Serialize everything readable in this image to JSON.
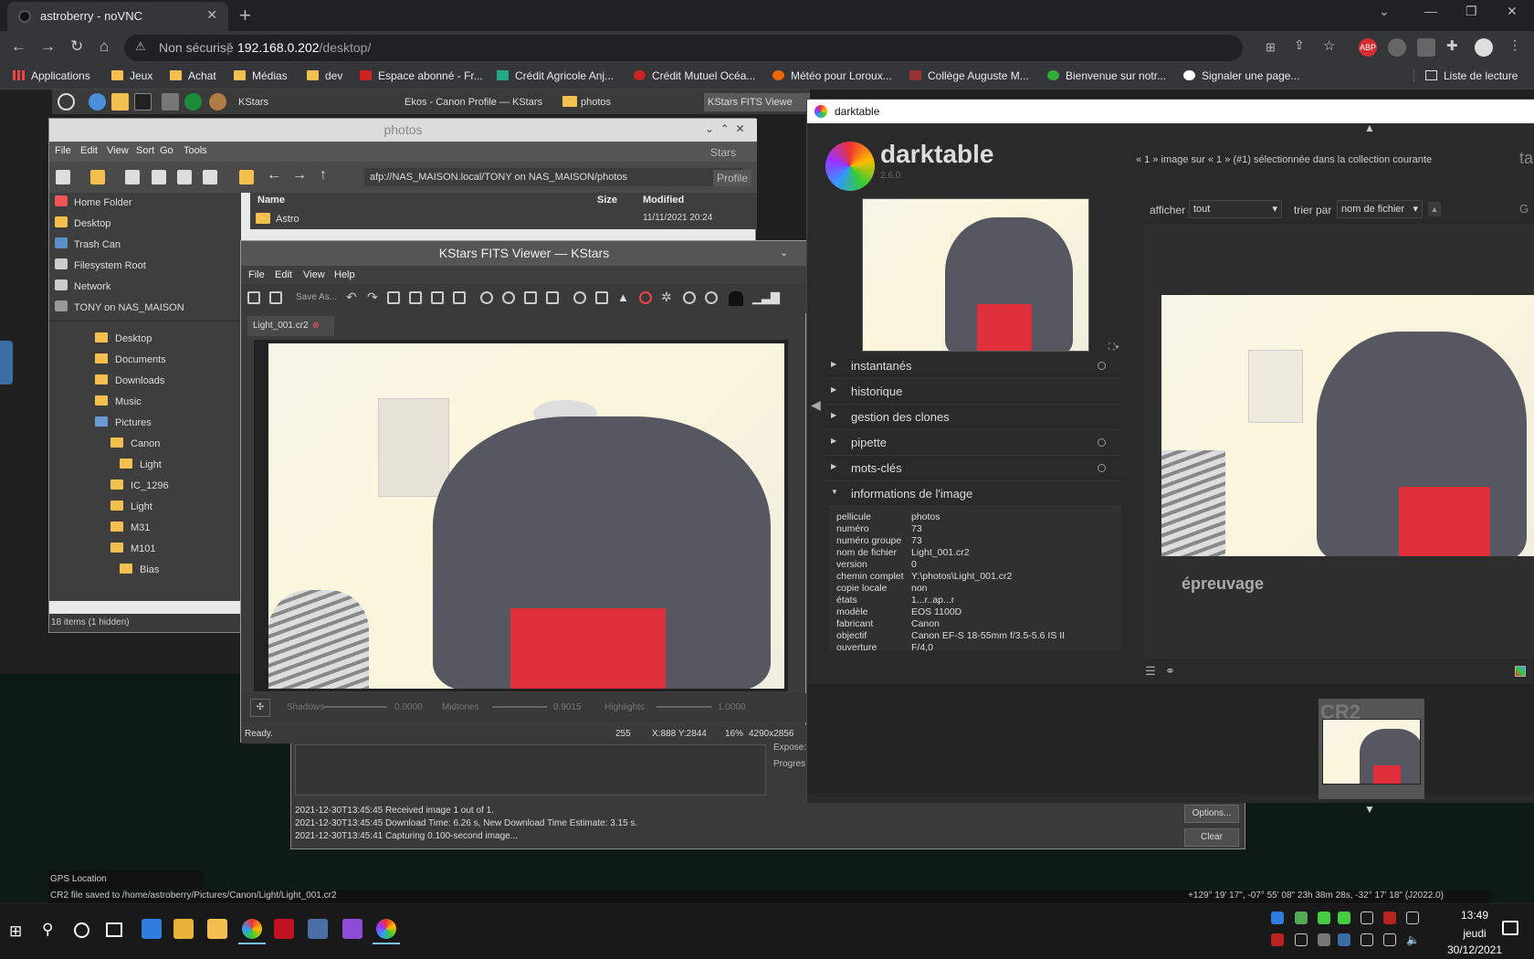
{
  "browser": {
    "tab_title": "astroberry - noVNC",
    "new_tab": "+",
    "url_prefix": "Non sécurisé",
    "url_host": "192.168.0.202",
    "url_path": "/desktop/",
    "bookmarks": [
      "Applications",
      "Jeux",
      "Achat",
      "Médias",
      "dev",
      "Espace abonné - Fr...",
      "Crédit Agricole Anj...",
      "Crédit Mutuel Océa...",
      "Météo pour Loroux...",
      "Collège Auguste M...",
      "Bienvenue sur notr...",
      "Signaler une page..."
    ],
    "reading_list": "Liste de lecture",
    "abp": "ABP"
  },
  "panel": {
    "tasks": [
      "KStars",
      "Ekos - Canon Profile — KStars",
      "photos",
      "KStars FITS Viewe"
    ]
  },
  "pcmanfm": {
    "title": "photos",
    "menu": [
      "File",
      "Edit",
      "View",
      "Sort",
      "Go",
      "Tools"
    ],
    "path": "afp://NAS_MAISON.local/TONY on NAS_MAISON/photos",
    "places": [
      "Home Folder",
      "Desktop",
      "Trash Can",
      "Filesystem Root",
      "Network",
      "TONY on NAS_MAISON"
    ],
    "tree": [
      "Desktop",
      "Documents",
      "Downloads",
      "Music",
      "Pictures",
      "Canon",
      "Light",
      "IC_1296",
      "Light",
      "M31",
      "M101",
      "Bias"
    ],
    "columns": [
      "Name",
      "Size",
      "Modified"
    ],
    "file": {
      "name": "Astro",
      "modified": "11/11/2021 20:24"
    },
    "status": "18 items (1 hidden)",
    "stars_tab": "Stars",
    "profile_tab": "Profile"
  },
  "ekos": {
    "log": [
      "2021-12-30T13:45:45 Received image 1 out of 1.",
      "2021-12-30T13:45:45 Download Time: 6.26 s, New Download Time Estimate: 3.15 s.",
      "2021-12-30T13:45:41 Capturing 0.100-second  image..."
    ],
    "options": "Options...",
    "clear": "Clear",
    "expose": "Expose:",
    "progress": "Progres"
  },
  "fits": {
    "title": "KStars FITS Viewer — KStars",
    "menu": [
      "File",
      "Edit",
      "View",
      "Help"
    ],
    "save_as": "Save As...",
    "tab": "Light_001.cr2",
    "shadows": "Shadows",
    "shadows_val": "0.0000",
    "midtones": "Midtones",
    "midtones_val": "0.9015",
    "highlights": "Highlights",
    "highlights_val": "1.0000",
    "status": "Ready.",
    "value": "255",
    "coords": "X:888 Y:2844",
    "zoom": "16%",
    "size": "4290x2856"
  },
  "darktable": {
    "title": "darktable",
    "name": "darktable",
    "version": "2.6.0",
    "collection": "« 1 » image sur « 1 » (#1) sélectionnée dans la collection courante",
    "show_label": "afficher",
    "show_value": "tout",
    "sort_label": "trier par",
    "sort_value": "nom de fichier",
    "modules": [
      "instantanés",
      "historique",
      "gestion des clones",
      "pipette",
      "mots-clés",
      "informations de l'image"
    ],
    "info": [
      {
        "k": "pellicule",
        "v": "photos"
      },
      {
        "k": "numéro",
        "v": "73"
      },
      {
        "k": "numéro groupe",
        "v": "73"
      },
      {
        "k": "nom de fichier",
        "v": "Light_001.cr2"
      },
      {
        "k": "version",
        "v": "0"
      },
      {
        "k": "chemin complet",
        "v": "Y:\\photos\\Light_001.cr2"
      },
      {
        "k": "copie locale",
        "v": "non"
      },
      {
        "k": "états",
        "v": "1...r..ap...r"
      },
      {
        "k": "modèle",
        "v": "EOS 1100D"
      },
      {
        "k": "fabricant",
        "v": "Canon"
      },
      {
        "k": "objectif",
        "v": "Canon EF-S 18-55mm f/3.5-5.6 IS II"
      },
      {
        "k": "ouverture",
        "v": "F/4,0"
      }
    ],
    "softproof": "épreuvage",
    "film_label": "CR2",
    "right_cut": "ta",
    "right_g": "G"
  },
  "remote_status": {
    "gps": "GPS Location",
    "saved": "CR2 file saved to /home/astroberry/Pictures/Canon/Light/Light_001.cr2",
    "coords": "+129° 19' 17\", -07° 55' 08\"  23h 38m 28s, -32° 17' 18\" (J2022.0)"
  },
  "taskbar": {
    "time": "13:49",
    "day": "jeudi",
    "date": "30/12/2021"
  }
}
